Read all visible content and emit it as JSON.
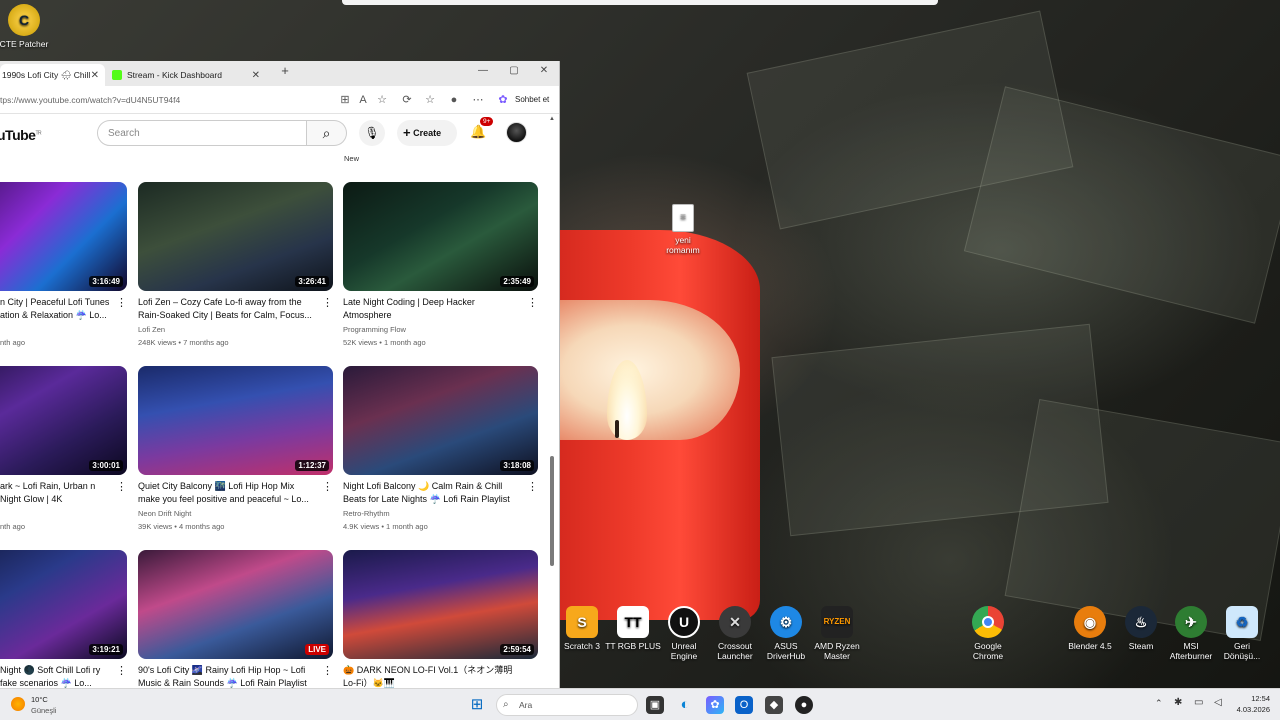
{
  "desktop": {
    "top_left_icon": {
      "label": "CTE Patcher",
      "icon": "cte-patcher-icon"
    },
    "file_icon": {
      "label_line1": "yeni",
      "label_line2": "romanım",
      "icon": "document-icon"
    },
    "bottom_icons": [
      {
        "label_line1": "Scratch 3",
        "label_line2": "",
        "icon": "scratch-icon",
        "color": "#f7a81b"
      },
      {
        "label_line1": "TT RGB PLUS",
        "label_line2": "",
        "icon": "tt-rgb-icon",
        "color": "#ffffff"
      },
      {
        "label_line1": "Unreal",
        "label_line2": "Engine",
        "icon": "unreal-engine-icon",
        "color": "#111111"
      },
      {
        "label_line1": "Crossout",
        "label_line2": "Launcher",
        "icon": "crossout-icon",
        "color": "#3a3a3a"
      },
      {
        "label_line1": "ASUS",
        "label_line2": "DriverHub",
        "icon": "asus-gear-icon",
        "color": "#1e88e5"
      },
      {
        "label_line1": "AMD Ryzen",
        "label_line2": "Master",
        "icon": "amd-ryzen-icon",
        "color": "#222222"
      },
      {
        "label_line1": "Google",
        "label_line2": "Chrome",
        "icon": "chrome-icon",
        "color": "#4285f4"
      },
      {
        "label_line1": "Blender 4.5",
        "label_line2": "",
        "icon": "blender-icon",
        "color": "#e87d0d"
      },
      {
        "label_line1": "Steam",
        "label_line2": "",
        "icon": "steam-icon",
        "color": "#1b2838"
      },
      {
        "label_line1": "MSI",
        "label_line2": "Afterburner",
        "icon": "msi-afterburner-icon",
        "color": "#2e7d32"
      },
      {
        "label_line1": "Geri",
        "label_line2": "Dönüşü...",
        "icon": "recycle-bin-icon",
        "color": "#90caf9"
      }
    ]
  },
  "browser": {
    "tabs": [
      {
        "label": "1990s Lofi City 🌧 Chill L",
        "close": "✕"
      },
      {
        "label": "Stream - Kick Dashboard",
        "close": "✕"
      }
    ],
    "new_tab": "+",
    "window_controls": {
      "minimize": "—",
      "maximize": "▢",
      "close": "✕"
    },
    "url": "tps://www.youtube.com/watch?v=dU4N5UT94f4",
    "copilot_label": "Sohbet et"
  },
  "youtube": {
    "logo_text": "uTube",
    "logo_sup": "TR",
    "search_placeholder": "Search",
    "create_label": "Create",
    "notification_badge": "9+",
    "tooltip": "New",
    "videos": [
      {
        "title": "n City | Peaceful Lofi Tunes ation & Relaxation ☔ Lo...",
        "channel": "",
        "meta": "nth ago",
        "duration": "3:16:49",
        "live": false
      },
      {
        "title": "Lofi Zen – Cozy Cafe Lo-fi away from the Rain-Soaked City | Beats for Calm, Focus...",
        "channel": "Lofi Zen",
        "meta": "248K views • 7 months ago",
        "duration": "3:26:41",
        "live": false
      },
      {
        "title": "Late Night Coding  | Deep Hacker Atmosphere",
        "channel": "Programming Flow",
        "meta": "52K views • 1 month ago",
        "duration": "2:35:49",
        "live": false
      },
      {
        "title": "ark ~ Lofi Rain, Urban n Night Glow | 4K",
        "channel": "",
        "meta": "nth ago",
        "duration": "3:00:01",
        "live": false
      },
      {
        "title": "Quiet City Balcony 🌃 Lofi Hip Hop Mix make you feel positive and peaceful ~ Lo...",
        "channel": "Neon Drift Night",
        "meta": "39K views • 4 months ago",
        "duration": "1:12:37",
        "live": false
      },
      {
        "title": "Night Lofi Balcony 🌙  Calm Rain & Chill Beats for Late Nights ☔ Lofi Rain Playlist",
        "channel": "Retro-Rhythm",
        "meta": "4.9K views • 1 month ago",
        "duration": "3:18:08",
        "live": false
      },
      {
        "title": "Night 🌑 Soft Chill Lofi ry fake scenarios ☔ Lo...",
        "channel": "",
        "meta": "",
        "duration": "3:19:21",
        "live": false
      },
      {
        "title": "90's Lofi City 🌌 Rainy Lofi Hip Hop ~ Lofi Music & Rain Sounds ☔ Lofi Rain Playlist",
        "channel": "",
        "meta": "",
        "duration": "LIVE",
        "live": true
      },
      {
        "title": "🎃 DARK NEON LO-FI Vol.1（ネオン薄明 Lo-Fi）🐱🎹",
        "channel": "",
        "meta": "",
        "duration": "2:59:54",
        "live": false
      }
    ]
  },
  "taskbar": {
    "weather_temp": "10°C",
    "weather_desc": "Güneşli",
    "search_placeholder": "Ara",
    "time": "12:54",
    "date": "4.03.2026"
  },
  "colors": {
    "accent": "#cc0000",
    "taskbar_bg": "#ecedf0",
    "candle": "#ee3a2a"
  }
}
